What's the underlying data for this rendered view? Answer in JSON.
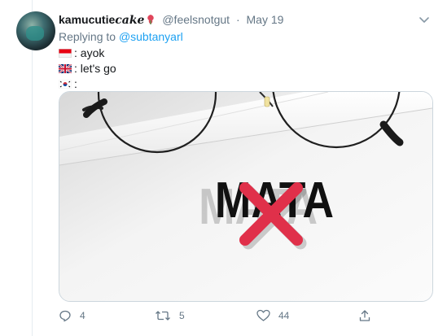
{
  "tweet": {
    "display_name": "kamucutie",
    "display_name_script": "cake",
    "handle": "@feelsnotgut",
    "separator": "·",
    "date": "May 19",
    "replying_to_prefix": "Replying to",
    "replying_to_handle": "@subtanyarl",
    "lines": [
      {
        "flag": "indonesia-flag-icon",
        "text": ": ayok"
      },
      {
        "flag": "uk-flag-icon",
        "text": ": let's go"
      },
      {
        "flag": "korea-flag-icon",
        "text": ":"
      }
    ],
    "image_text": "MATA"
  },
  "actions": {
    "reply_count": "4",
    "retweet_count": "5",
    "like_count": "44"
  },
  "icons": [
    "avatar",
    "rose-icon",
    "chevron-down-icon",
    "reply-icon",
    "retweet-icon",
    "like-icon",
    "share-icon"
  ],
  "colors": {
    "link": "#1da1f2",
    "meta": "#657786",
    "cross": "#e0304a"
  }
}
